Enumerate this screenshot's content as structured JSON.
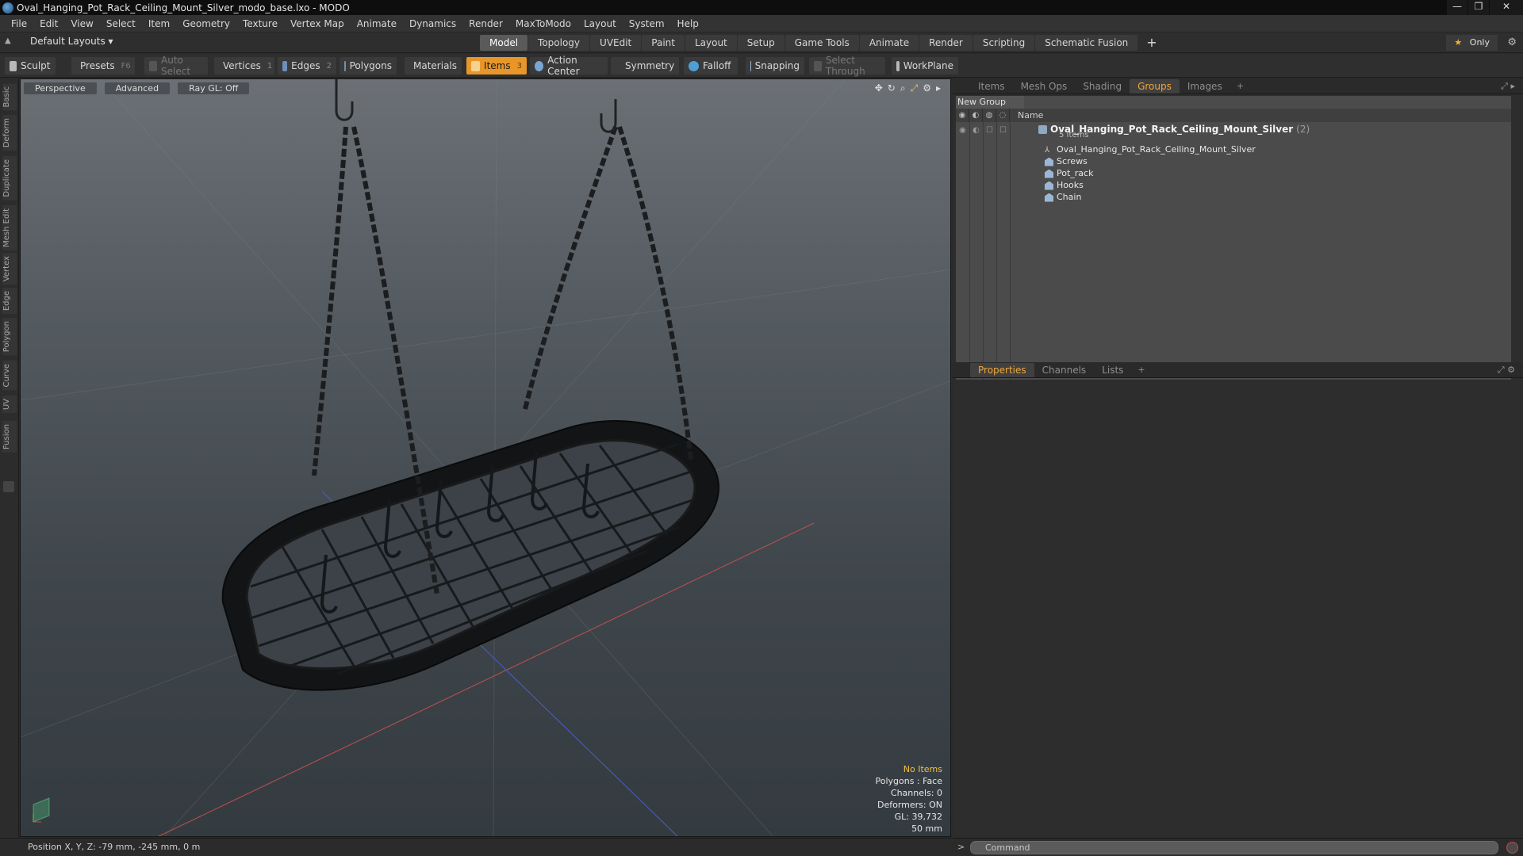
{
  "window": {
    "title": "Oval_Hanging_Pot_Rack_Ceiling_Mount_Silver_modo_base.lxo - MODO",
    "controls": [
      "—",
      "❐",
      "✕"
    ]
  },
  "menu": [
    "File",
    "Edit",
    "View",
    "Select",
    "Item",
    "Geometry",
    "Texture",
    "Vertex Map",
    "Animate",
    "Dynamics",
    "Render",
    "MaxToModo",
    "Layout",
    "System",
    "Help"
  ],
  "layout": {
    "preset": "Default Layouts ▾",
    "tabs": [
      "Model",
      "Topology",
      "UVEdit",
      "Paint",
      "Layout",
      "Setup",
      "Game Tools",
      "Animate",
      "Render",
      "Scripting",
      "Schematic Fusion"
    ],
    "active_tab": "Model",
    "add": "+",
    "only": "Only"
  },
  "toolbar": {
    "sculpt": "Sculpt",
    "presets": "Presets",
    "presets_key": "F6",
    "auto_select": "Auto Select",
    "vertices": "Vertices",
    "vertices_count": "1",
    "edges": "Edges",
    "edges_count": "2",
    "polygons": "Polygons",
    "materials": "Materials",
    "items": "Items",
    "items_count": "3",
    "action_center": "Action Center",
    "symmetry": "Symmetry",
    "falloff": "Falloff",
    "snapping": "Snapping",
    "select_through": "Select Through",
    "workplane": "WorkPlane"
  },
  "left_tabs": [
    "Basic",
    "Deform",
    "Duplicate",
    "Mesh Edit",
    "Vertex",
    "Edge",
    "Polygon",
    "Curve",
    "UV",
    "Fusion"
  ],
  "viewport": {
    "view": "Perspective",
    "shading": "Advanced",
    "raygl": "Ray GL: Off",
    "info": {
      "selection": "No Items",
      "polygons": "Polygons : Face",
      "channels": "Channels: 0",
      "deformers": "Deformers: ON",
      "gl": "GL: 39,732",
      "scale": "50 mm"
    }
  },
  "status": {
    "position": "Position X, Y, Z:  -79 mm, -245 mm, 0 m"
  },
  "panel_tabs": {
    "items": [
      "Items",
      "Mesh Ops",
      "Shading",
      "Groups",
      "Images"
    ],
    "active": "Groups",
    "add": "+"
  },
  "groups": {
    "new_group": "New Group",
    "column_name": "Name",
    "group_name": "Oval_Hanging_Pot_Rack_Ceiling_Mount_Silver",
    "group_count": "(2)",
    "subtitle": "5 Items",
    "children": [
      "Oval_Hanging_Pot_Rack_Ceiling_Mount_Silver",
      "Screws",
      "Pot_rack",
      "Hooks",
      "Chain"
    ]
  },
  "props_tabs": {
    "items": [
      "Properties",
      "Channels",
      "Lists"
    ],
    "active": "Properties",
    "add": "+"
  },
  "command": {
    "placeholder": "Command"
  },
  "colors": {
    "accent": "#e8962a",
    "warn_text": "#f4c040",
    "viewport_top": "#6c7075",
    "viewport_bottom": "#343b40"
  }
}
